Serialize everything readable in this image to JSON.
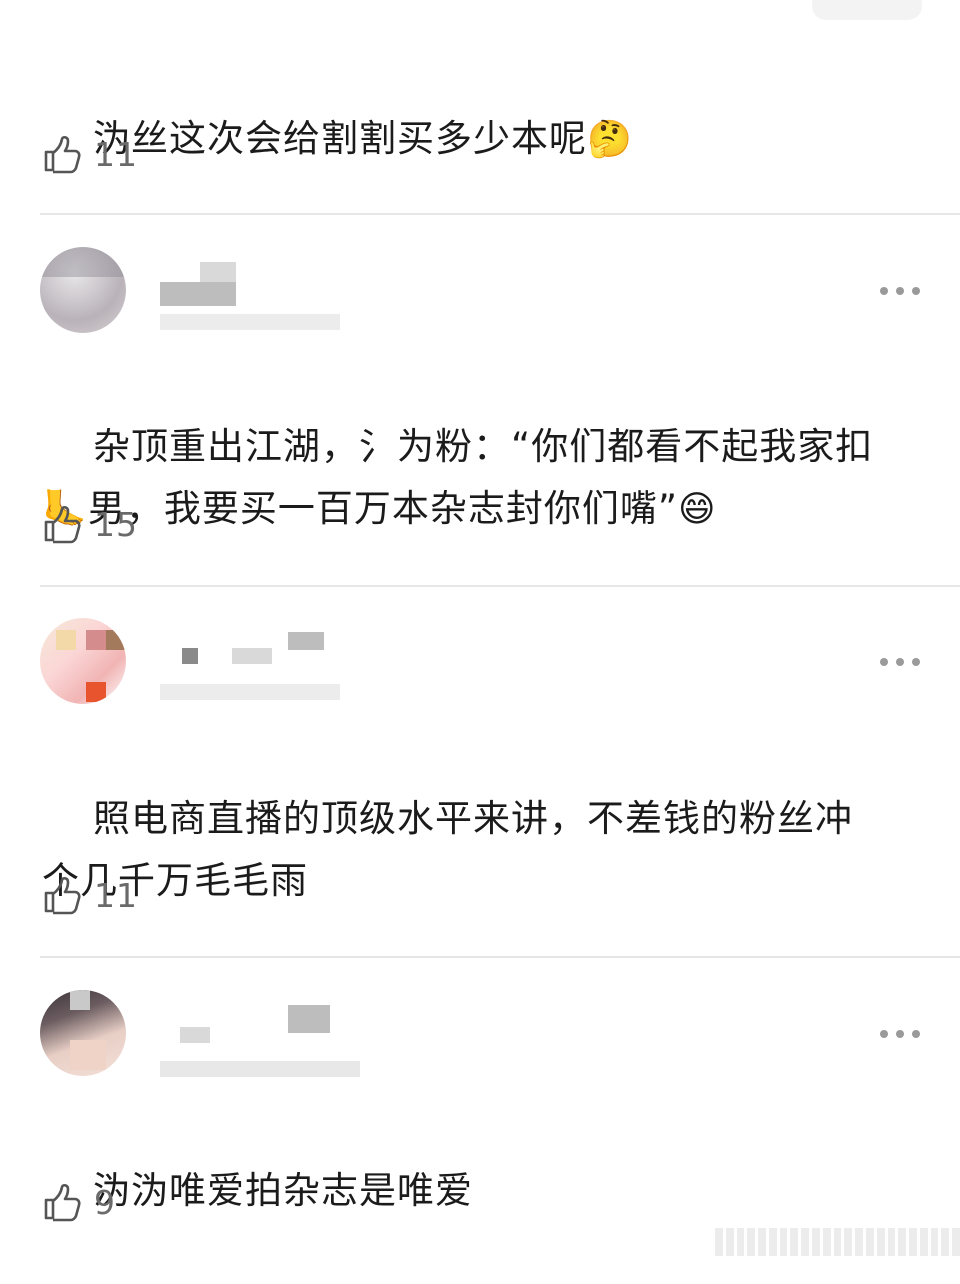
{
  "comments": [
    {
      "text": "沩丝这次会给割割买多少本呢",
      "emoji": "🤔",
      "likes": "11"
    },
    {
      "text": "杂顶重出江湖，氵为粉：“你们都看不起我家扣\n",
      "emoji_lead": "🦶",
      "text_after_emoji": "男，我要买一百万本杂志封你们嘴”",
      "emoji": "😄",
      "likes": "15"
    },
    {
      "text": "照电商直播的顶级水平来讲，不差钱的粉丝冲\n个几千万毛毛雨",
      "likes": "11"
    },
    {
      "text": "沩沩唯爱拍杂志是唯爱",
      "likes": "9"
    }
  ],
  "icons": {
    "like": "thumbs-up-icon",
    "more": "more-dots-icon"
  },
  "colors": {
    "background": "#ffffff",
    "text": "#1b1b1b",
    "meta": "#6a6a6a",
    "divider": "#e6e6e6"
  }
}
